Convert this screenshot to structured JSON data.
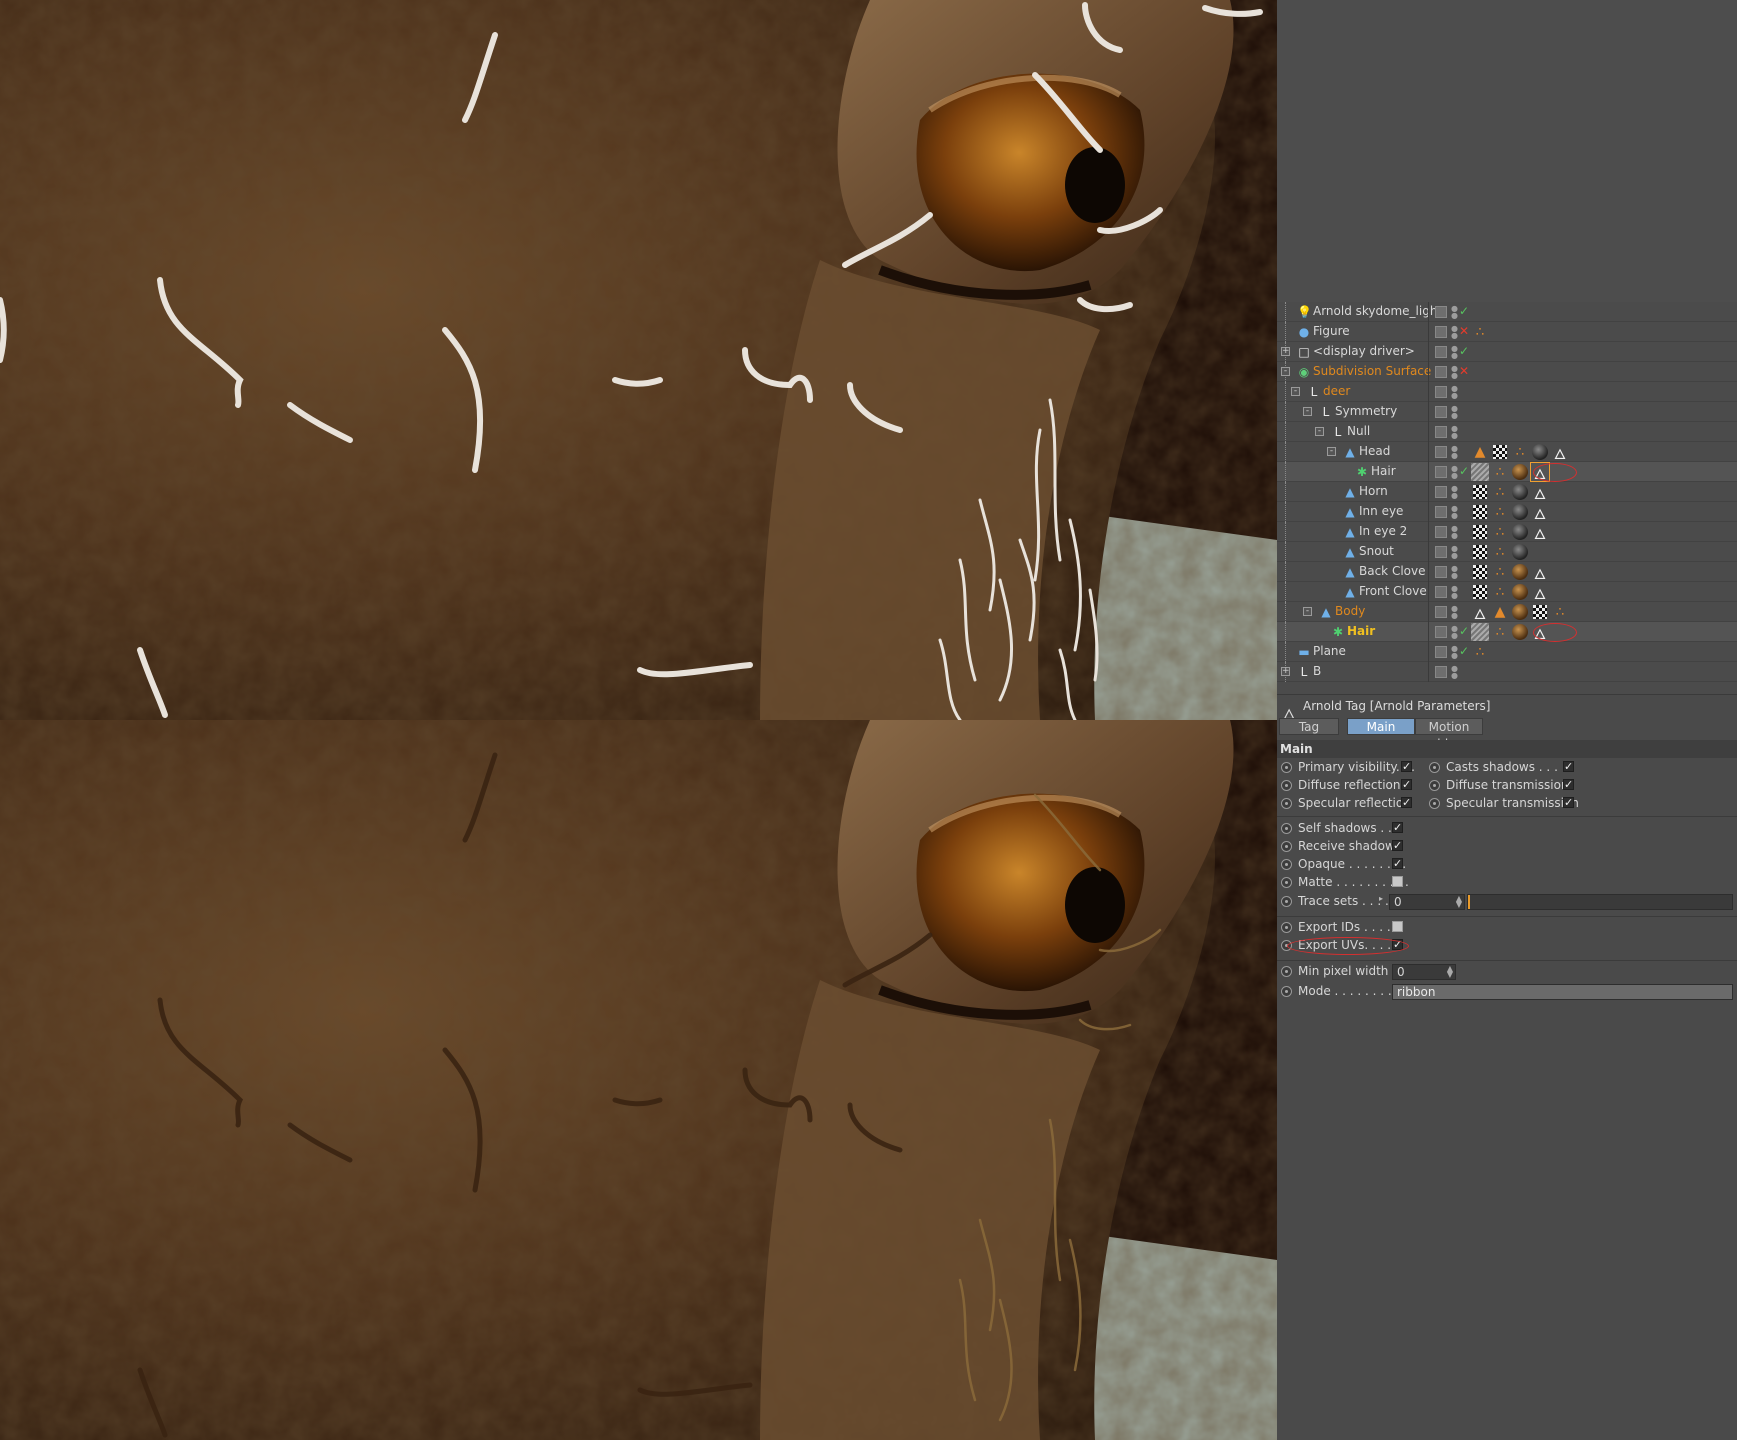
{
  "object_manager": {
    "rows": [
      {
        "label": "Arnold skydome_light",
        "icon": "bulb-icon",
        "status": "check",
        "style": "normal"
      },
      {
        "label": "Figure",
        "icon": "figure-icon",
        "status": "cross",
        "style": "normal"
      },
      {
        "label": "<display driver>",
        "icon": "document-icon",
        "status": "check",
        "style": "normal"
      },
      {
        "label": "Subdivision Surface",
        "icon": "subdivision-icon",
        "status": "cross",
        "style": "orange"
      },
      {
        "label": "deer",
        "icon": "null-icon",
        "status": "none",
        "style": "orange"
      },
      {
        "label": "Symmetry",
        "icon": "null-icon",
        "status": "none",
        "style": "normal"
      },
      {
        "label": "Null",
        "icon": "null-icon",
        "status": "none",
        "style": "normal"
      },
      {
        "label": "Head",
        "icon": "polygon-icon",
        "status": "none",
        "style": "normal"
      },
      {
        "label": "Hair",
        "icon": "hair-icon",
        "status": "check",
        "style": "normal"
      },
      {
        "label": "Horn",
        "icon": "polygon-icon",
        "status": "none",
        "style": "normal"
      },
      {
        "label": "Inn eye",
        "icon": "polygon-icon",
        "status": "none",
        "style": "normal"
      },
      {
        "label": "In eye 2",
        "icon": "polygon-icon",
        "status": "none",
        "style": "normal"
      },
      {
        "label": "Snout",
        "icon": "polygon-icon",
        "status": "none",
        "style": "normal"
      },
      {
        "label": "Back Clove",
        "icon": "polygon-icon",
        "status": "none",
        "style": "normal"
      },
      {
        "label": "Front Clove",
        "icon": "polygon-icon",
        "status": "none",
        "style": "normal"
      },
      {
        "label": "Body",
        "icon": "polygon-icon",
        "status": "none",
        "style": "orange"
      },
      {
        "label": "Hair",
        "icon": "hair-icon",
        "status": "check",
        "style": "yellow"
      },
      {
        "label": "Plane",
        "icon": "plane-icon",
        "status": "check",
        "style": "normal"
      },
      {
        "label": "B",
        "icon": "null-icon",
        "status": "none",
        "style": "normal"
      }
    ]
  },
  "attribute_manager": {
    "title": "Arnold Tag [Arnold Parameters]",
    "tabs": [
      {
        "label": "Tag",
        "active": false
      },
      {
        "label": "Main",
        "active": true
      },
      {
        "label": "Motion blur",
        "active": false
      }
    ],
    "section_title": "Main",
    "params_left": [
      {
        "label": "Primary visibility. . .",
        "checked": true
      },
      {
        "label": "Diffuse reflection",
        "checked": true
      },
      {
        "label": "Specular reflection",
        "checked": true
      }
    ],
    "params_right": [
      {
        "label": "Casts shadows . . . . .",
        "checked": true
      },
      {
        "label": "Diffuse transmission",
        "checked": true
      },
      {
        "label": "Specular transmission",
        "checked": true
      }
    ],
    "shadow_params": [
      {
        "label": "Self shadows . . .",
        "checked": true
      },
      {
        "label": "Receive shadows",
        "checked": true
      },
      {
        "label": "Opaque . . . . . . . .",
        "checked": true
      },
      {
        "label": "Matte . . . . . . . . . .",
        "checked": false
      }
    ],
    "trace_sets": {
      "label": "Trace sets . . . .",
      "value": "0"
    },
    "export_ids": {
      "label": "Export IDs . . . . .",
      "checked": false
    },
    "export_uvs": {
      "label": "Export UVs. . . . .",
      "checked": true
    },
    "min_pixel_width": {
      "label": "Min pixel width",
      "value": "0"
    },
    "mode": {
      "label": "Mode . . . . . . . . .",
      "value": "ribbon"
    }
  },
  "colors": {
    "panel_bg": "#4a4a4a",
    "accent_tab": "#7aa0c8",
    "orange_text": "#e0891e",
    "selected_text": "#f0c020",
    "annotation_red": "#d33030"
  }
}
